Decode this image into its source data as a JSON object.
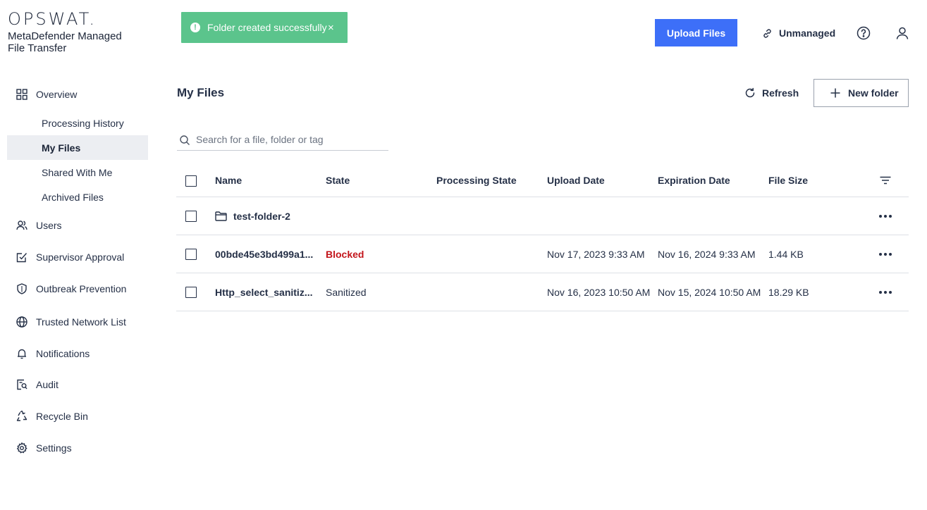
{
  "brand": {
    "logo": "OPSWAT.",
    "product": "MetaDefender Managed File Transfer"
  },
  "toast": {
    "icon": "info-icon",
    "message": "Folder created successfully",
    "close": "×",
    "color": "#5bc48c"
  },
  "header": {
    "upload_label": "Upload Files",
    "unmanaged_label": "Unmanaged",
    "accent_color": "#3d6ff8"
  },
  "sidebar": {
    "items": [
      {
        "label": "Overview",
        "icon": "grid-icon"
      },
      {
        "label": "Processing History"
      },
      {
        "label": "My Files",
        "active": true
      },
      {
        "label": "Shared With Me"
      },
      {
        "label": "Archived Files"
      },
      {
        "label": "Users",
        "icon": "users-icon"
      },
      {
        "label": "Supervisor Approval",
        "icon": "approval-icon"
      },
      {
        "label": "Outbreak Prevention",
        "icon": "shield-icon"
      },
      {
        "label": "Trusted Network List",
        "icon": "globe-icon"
      },
      {
        "label": "Notifications",
        "icon": "bell-icon"
      },
      {
        "label": "Audit",
        "icon": "audit-icon"
      },
      {
        "label": "Recycle Bin",
        "icon": "recycle-icon"
      },
      {
        "label": "Settings",
        "icon": "gear-icon"
      }
    ]
  },
  "main": {
    "title": "My Files",
    "refresh_label": "Refresh",
    "new_folder_label": "New folder",
    "search_placeholder": "Search for a file, folder or tag",
    "table": {
      "columns": [
        "Name",
        "State",
        "Processing State",
        "Upload Date",
        "Expiration Date",
        "File Size"
      ],
      "rows": [
        {
          "type": "folder",
          "name": "test-folder-2",
          "state": "",
          "processing_state": "",
          "upload_date": "",
          "expiration_date": "",
          "size": ""
        },
        {
          "type": "file",
          "name": "00bde45e3bd499a1...",
          "state": "Blocked",
          "processing_state": "",
          "upload_date": "Nov 17, 2023 9:33 AM",
          "expiration_date": "Nov 16, 2024 9:33 AM",
          "size": "1.44 KB"
        },
        {
          "type": "file",
          "name": "Http_select_sanitiz...",
          "state": "Sanitized",
          "processing_state": "",
          "upload_date": "Nov 16, 2023 10:50 AM",
          "expiration_date": "Nov 15, 2024 10:50 AM",
          "size": "18.29 KB"
        }
      ]
    },
    "blocked_color": "#c3151b"
  }
}
